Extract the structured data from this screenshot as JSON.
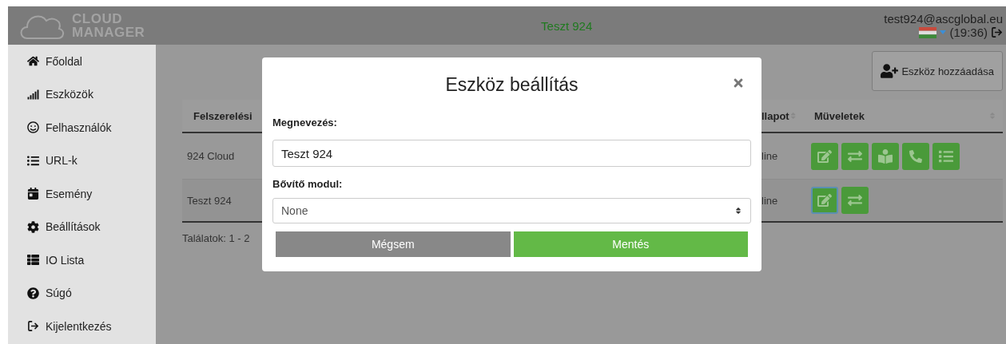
{
  "header": {
    "logo": {
      "line1": "CLOUD",
      "line2": "MANAGER"
    },
    "title": "Teszt 924",
    "user": {
      "email": "test924@ascglobal.eu",
      "time": "(19:36)"
    }
  },
  "sidebar": {
    "items": [
      {
        "kind": "home",
        "label": "Főoldal"
      },
      {
        "kind": "chart",
        "label": "Eszközök"
      },
      {
        "kind": "users",
        "label": "Felhasználók"
      },
      {
        "kind": "list",
        "label": "URL-k"
      },
      {
        "kind": "calendar",
        "label": "Esemény"
      },
      {
        "kind": "settings",
        "label": "Beállítások"
      },
      {
        "kind": "table",
        "label": "IO Lista"
      },
      {
        "kind": "help",
        "label": "Súgó"
      },
      {
        "kind": "logout",
        "label": "Kijelentkezés"
      }
    ]
  },
  "toolbar": {
    "add_button": "Eszköz hozzáadása"
  },
  "table": {
    "columns": [
      "Felszerelési",
      "llapot",
      "Müveletek"
    ],
    "rows": [
      {
        "cells": [
          "924 Cloud",
          "line"
        ],
        "actions": [
          {
            "kind": "edit",
            "focused": false
          },
          {
            "kind": "exchange",
            "focused": false
          },
          {
            "kind": "reader",
            "focused": false
          },
          {
            "kind": "phone",
            "focused": false
          },
          {
            "kind": "list",
            "focused": false
          }
        ]
      },
      {
        "cells": [
          "Teszt 924",
          "line"
        ],
        "actions": [
          {
            "kind": "edit",
            "focused": true
          },
          {
            "kind": "exchange",
            "focused": false
          }
        ]
      }
    ]
  },
  "footer": {
    "results": "Találatok: 1 - 2"
  },
  "modal": {
    "title": "Eszköz beállítás",
    "fields": [
      {
        "kind": "text",
        "label": "Megnevezés:",
        "value": "Teszt 924"
      },
      {
        "kind": "select",
        "label": "Bővítő modul:",
        "value": "None"
      }
    ],
    "buttons": [
      {
        "kind": "cancel",
        "label": "Mégsem"
      },
      {
        "kind": "save",
        "label": "Mentés"
      }
    ]
  }
}
